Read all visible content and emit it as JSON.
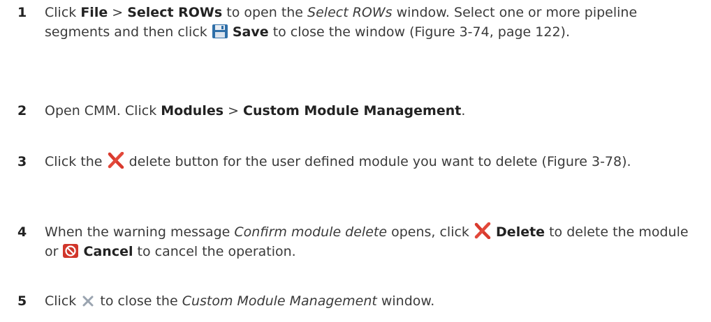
{
  "steps": [
    {
      "number": "1",
      "t1": "Click ",
      "b1": "File",
      "t2": " > ",
      "b2": "Select ROWs",
      "t3": " to open the ",
      "i1": "Select ROWs",
      "t4": " window. Select one or more pipeline segments and then click ",
      "icon": "save-icon",
      "b3": "Save",
      "t5": " to close the window (Figure 3-74, page 122)."
    },
    {
      "number": "2",
      "t1": "Open CMM. Click ",
      "b1": "Modules",
      "t2": " > ",
      "b2": "Custom Module Management",
      "t3": "."
    },
    {
      "number": "3",
      "t1": "Click the ",
      "icon": "delete-x-icon",
      "t2": " delete button for the user defined module you want to delete (Figure 3-78)."
    },
    {
      "number": "4",
      "t1": "When the warning message ",
      "i1": "Confirm module delete",
      "t2": " opens, click ",
      "icon1": "delete-x-icon",
      "b1": "Delete",
      "t3": " to delete the module or ",
      "icon2": "cancel-icon",
      "b2": "Cancel",
      "t4": " to cancel the operation."
    },
    {
      "number": "5",
      "t1": "Click ",
      "icon": "close-window-icon",
      "t2": " to close the ",
      "i1": "Custom Module Management",
      "t3": " window."
    }
  ],
  "colors": {
    "text": "#3a3a3a",
    "bold_text": "#222222",
    "save_icon": "#2f6fa8",
    "delete_icon": "#d93a2e",
    "cancel_icon": "#d1362b",
    "close_icon": "#9aa4b0"
  }
}
